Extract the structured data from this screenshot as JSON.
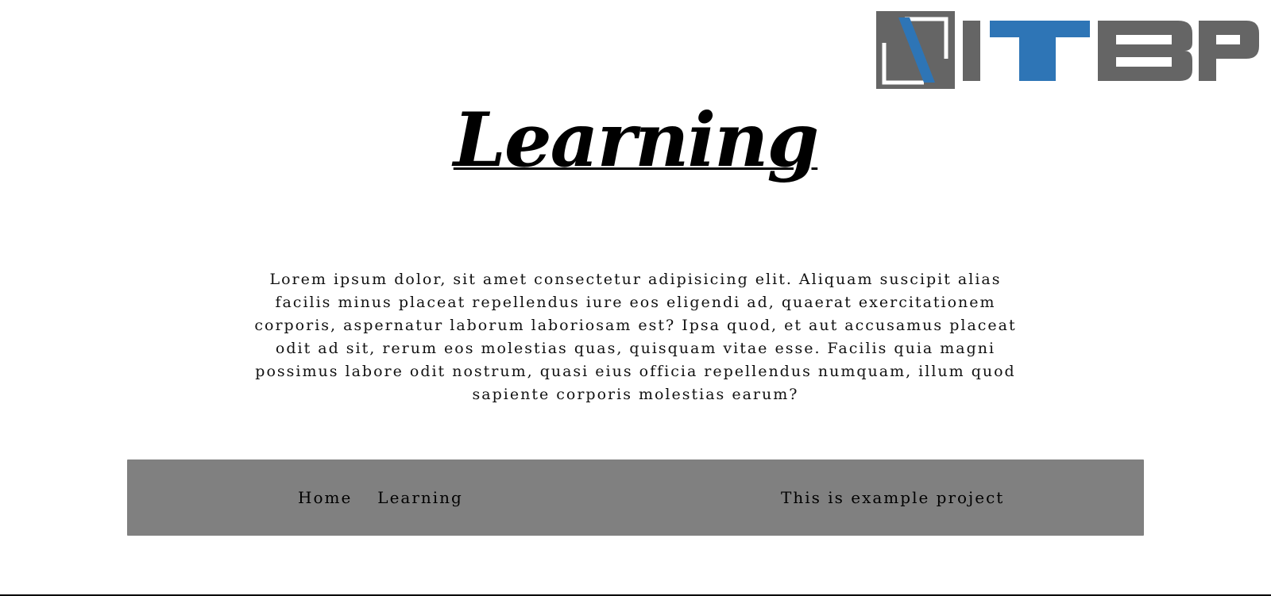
{
  "header": {
    "logo_text": "ITBP"
  },
  "main": {
    "title": "Learning",
    "intro": "Lorem ipsum dolor, sit amet consectetur adipisicing elit. Aliquam suscipit alias facilis minus placeat repellendus iure eos eligendi ad, quaerat exercitationem corporis, aspernatur laborum laboriosam est? Ipsa quod, et aut accusamus placeat odit ad sit, rerum eos molestias quas, quisquam vitae esse. Facilis quia magni possimus labore odit nostrum, quasi eius officia repellendus numquam, illum quod sapiente corporis molestias earum?"
  },
  "footer": {
    "nav": [
      {
        "label": "Home"
      },
      {
        "label": "Learning"
      }
    ],
    "note": "This is example project"
  },
  "colors": {
    "footer_bg": "#808080",
    "logo_gray": "#656565",
    "logo_blue": "#2e75b6"
  }
}
